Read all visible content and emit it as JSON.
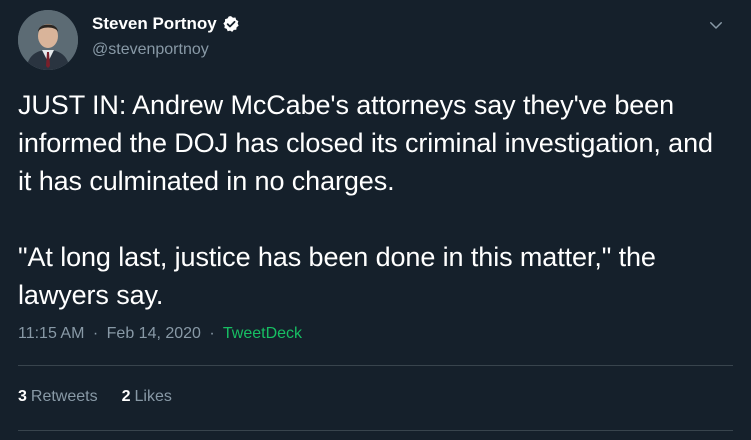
{
  "author": {
    "name": "Steven Portnoy",
    "handle": "@stevenportnoy",
    "verified": true
  },
  "tweet": {
    "text": "JUST IN: Andrew McCabe's attorneys say they've been informed the DOJ has closed its criminal investigation, and it has culminated in no charges.\n\n\"At long last, justice has been done in this matter,\" the lawyers say.",
    "time": "11:15 AM",
    "separator1": "·",
    "date": "Feb 14, 2020",
    "separator2": "·",
    "source": "TweetDeck"
  },
  "stats": {
    "retweets_count": "3",
    "retweets_label": "Retweets",
    "likes_count": "2",
    "likes_label": "Likes"
  },
  "colors": {
    "background": "#15202b",
    "text": "#ffffff",
    "muted": "#8899a6",
    "source": "#17bf63",
    "verified": "#ffffff",
    "divider": "#38444d"
  },
  "icons": {
    "verified": "verified-badge-icon",
    "caret": "chevron-down-icon"
  }
}
